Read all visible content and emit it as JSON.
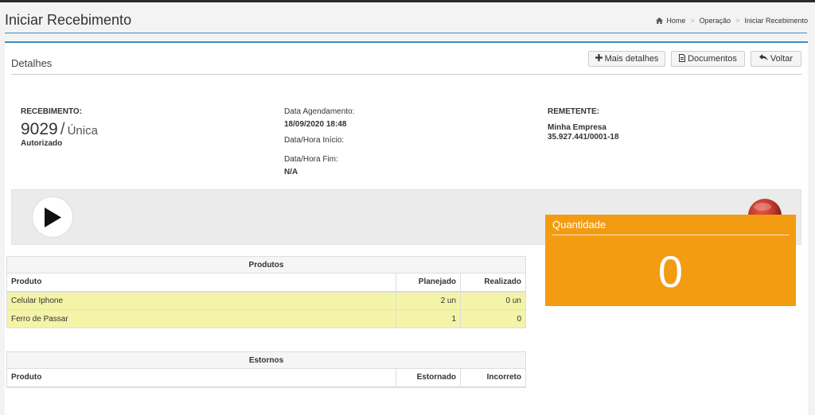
{
  "header": {
    "title": "Iniciar Recebimento",
    "breadcrumb": [
      "Home",
      "Operação",
      "Iniciar Recebimento"
    ]
  },
  "panel": {
    "title": "Detalhes",
    "buttons": {
      "mais_detalhes": "Mais detalhes",
      "documentos": "Documentos",
      "voltar": "Voltar"
    }
  },
  "recebimento": {
    "label": "RECEBIMENTO:",
    "numero": "9029",
    "tipo": "Única",
    "status": "Autorizado"
  },
  "datas": {
    "agendamento_label": "Data Agendamento:",
    "agendamento_valor": "18/09/2020 18:48",
    "inicio_label": "Data/Hora Início:",
    "inicio_valor": "",
    "fim_label": "Data/Hora Fim:",
    "fim_valor": "N/A"
  },
  "remetente": {
    "label": "REMETENTE:",
    "nome": "Minha Empresa",
    "cnpj": "35.927.441/0001-18"
  },
  "controls": {
    "play_icon": "play-icon",
    "status_light_icon": "red-record-light-icon",
    "status_light_color": "#c0392b"
  },
  "produtos": {
    "caption": "Produtos",
    "columns": [
      "Produto",
      "Planejado",
      "Realizado"
    ],
    "rows": [
      {
        "produto": "Celular Iphone",
        "planejado": "2 un",
        "realizado": "0 un"
      },
      {
        "produto": "Ferro de Passar",
        "planejado": "1",
        "realizado": "0"
      }
    ]
  },
  "estornos": {
    "caption": "Estornos",
    "columns": [
      "Produto",
      "Estornado",
      "Incorreto"
    ]
  },
  "quantidade": {
    "title": "Quantidade",
    "valor": "0",
    "color": "#f39c12"
  },
  "colors": {
    "accent": "#3c8dbc",
    "row_highlight": "#f4f4a8"
  }
}
